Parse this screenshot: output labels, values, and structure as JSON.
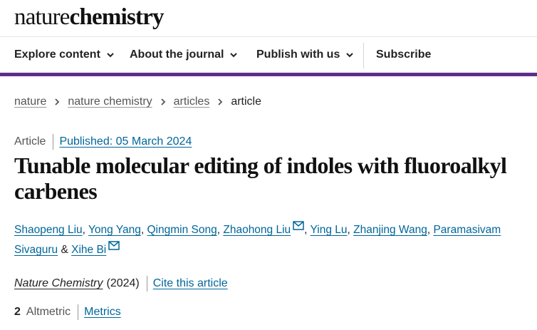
{
  "site": {
    "logo_part1": "nature",
    "logo_part2": "chemistry"
  },
  "nav": {
    "items": [
      {
        "label": "Explore content",
        "has_dropdown": true
      },
      {
        "label": "About the journal",
        "has_dropdown": true
      },
      {
        "label": "Publish with us",
        "has_dropdown": true
      },
      {
        "label": "Subscribe",
        "has_dropdown": false
      }
    ],
    "accent_color": "#5f2e8c"
  },
  "breadcrumb": {
    "items": [
      "nature",
      "nature chemistry",
      "articles"
    ],
    "current": "article"
  },
  "article": {
    "type": "Article",
    "published": "Published: 05 March 2024",
    "title": "Tunable molecular editing of indoles with fluoroalkyl carbenes",
    "authors": [
      "Shaopeng Liu",
      "Yong Yang",
      "Qingmin Song",
      "Zhaohong Liu",
      "Ying Lu",
      "Zhanjing Wang",
      "Paramasivam Sivaguru",
      "Xihe Bi"
    ],
    "author_separator": ", ",
    "author_last_separator": " & ",
    "journal": "Nature Chemistry",
    "year": "(2024)",
    "cite_label": "Cite this article",
    "altmetric_count": "2",
    "altmetric_label": "Altmetric",
    "metrics_label": "Metrics",
    "link_color": "#006699"
  }
}
